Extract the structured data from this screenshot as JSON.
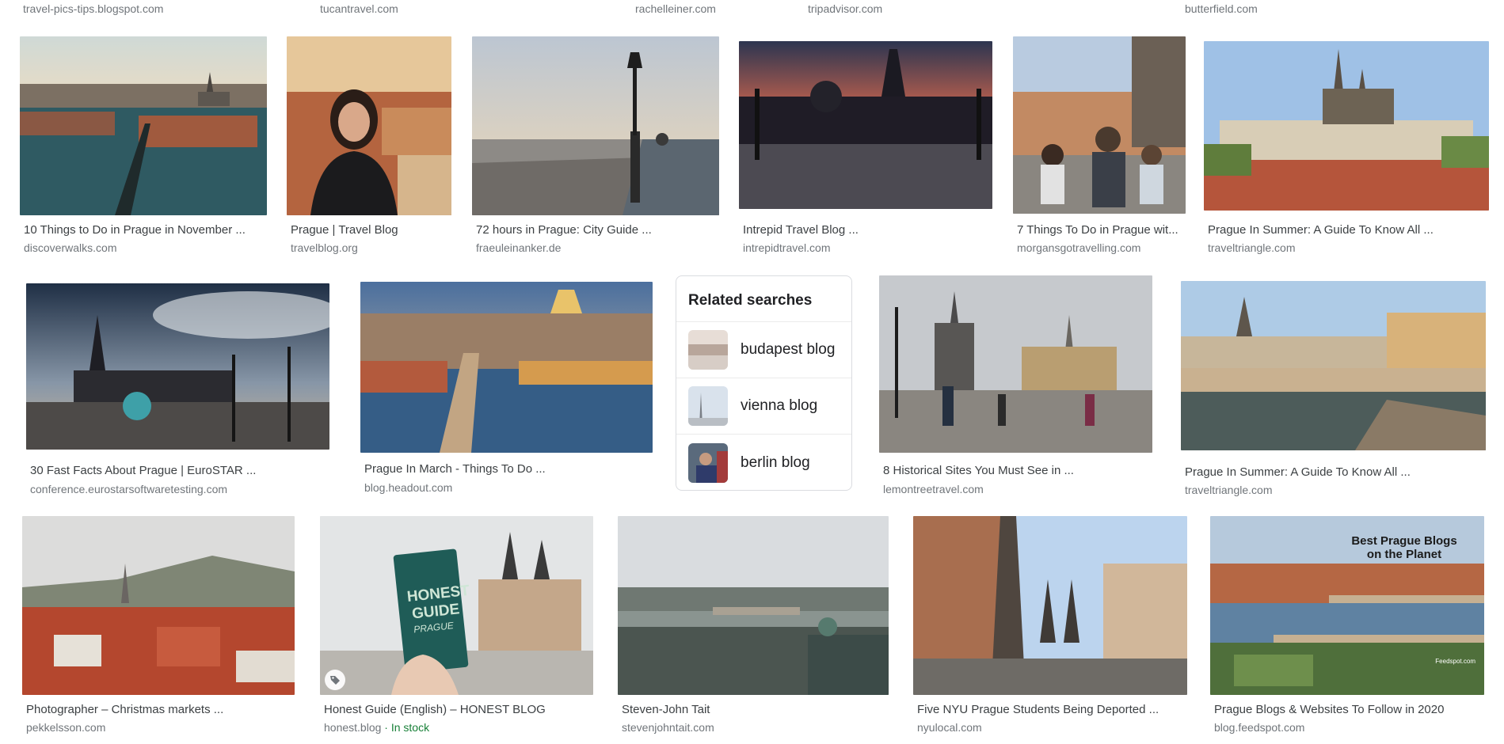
{
  "top_sources": [
    "travel-pics-tips.blogspot.com",
    "tucantravel.com",
    "rachelleiner.com",
    "tripadvisor.com",
    "butterfield.com"
  ],
  "results": [
    {
      "title": "10 Things to Do in Prague in November ...",
      "source": "discoverwalks.com"
    },
    {
      "title": "Prague | Travel Blog",
      "source": "travelblog.org"
    },
    {
      "title": "72 hours in Prague: City Guide ...",
      "source": "fraeuleinanker.de"
    },
    {
      "title": "Intrepid Travel Blog ...",
      "source": "intrepidtravel.com"
    },
    {
      "title": "7 Things To Do in Prague wit...",
      "source": "morgansgotravelling.com"
    },
    {
      "title": "Prague In Summer: A Guide To Know All ...",
      "source": "traveltriangle.com"
    },
    {
      "title": "30 Fast Facts About Prague | EuroSTAR ...",
      "source": "conference.eurostarsoftwaretesting.com"
    },
    {
      "title": "Prague In March - Things To Do ...",
      "source": "blog.headout.com"
    },
    {
      "title": "8 Historical Sites You Must See in ...",
      "source": "lemontreetravel.com"
    },
    {
      "title": "Prague In Summer: A Guide To Know All ...",
      "source": "traveltriangle.com"
    },
    {
      "title": "Photographer – Christmas markets ...",
      "source": "pekkelsson.com"
    },
    {
      "title": "Honest Guide (English) – HONEST BLOG",
      "source": "honest.blog",
      "stock": " · In stock",
      "tag_icon": "tag-icon"
    },
    {
      "title": "Steven-John Tait",
      "source": "stevenjohntait.com"
    },
    {
      "title": "Five NYU Prague Students Being Deported ...",
      "source": "nyulocal.com"
    },
    {
      "title": "Prague Blogs & Websites To Follow in 2020",
      "source": "blog.feedspot.com"
    }
  ],
  "image_overlays": {
    "honest_guide_book": [
      "HONEST",
      "GUIDE",
      "PRAGUE"
    ],
    "best_blogs_banner": [
      "Best Prague Blogs",
      "on the Planet"
    ],
    "feedspot_watermark": "Feedspot.com"
  },
  "related_searches": {
    "title": "Related searches",
    "items": [
      "budapest blog",
      "vienna blog",
      "berlin blog"
    ]
  },
  "colors": {
    "title_text": "#3c4043",
    "source_text": "#70757a",
    "in_stock": "#188038",
    "card_border": "#dadce0"
  }
}
